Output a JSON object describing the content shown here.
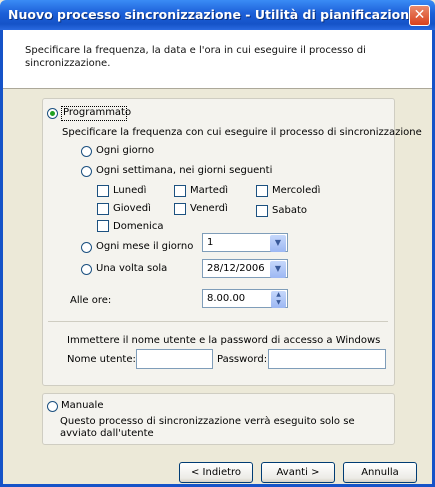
{
  "window": {
    "title": "Nuovo processo sincronizzazione - Utilità di pianificazione",
    "close_symbol": "✕"
  },
  "header": {
    "description": "Specificare la frequenza, la data e l'ora in cui eseguire il processo di sincronizzazione."
  },
  "scheduled": {
    "radio_label": "Programmato",
    "frequency_prompt": "Specificare la frequenza con cui eseguire il processo di sincronizzazione",
    "options": {
      "daily": "Ogni giorno",
      "weekly": "Ogni settimana, nei giorni seguenti",
      "monthly": "Ogni mese il giorno",
      "once": "Una volta sola"
    },
    "days": {
      "mon": "Lunedì",
      "tue": "Martedì",
      "wed": "Mercoledì",
      "thu": "Giovedì",
      "fri": "Venerdì",
      "sat": "Sabato",
      "sun": "Domenica"
    },
    "monthly_day_value": "1",
    "once_date_value": "28/12/2006",
    "time_label": "Alle ore:",
    "time_value": "8.00.00",
    "credentials_prompt": "Immettere il nome utente e la password di accesso a Windows",
    "username_label": "Nome utente:",
    "username_value": "",
    "password_label": "Password:",
    "password_value": ""
  },
  "manual": {
    "radio_label": "Manuale",
    "description": "Questo processo di sincronizzazione verrà eseguito solo se avviato dall'utente"
  },
  "buttons": {
    "back": "< Indietro",
    "next": "Avanti >",
    "cancel": "Annulla"
  },
  "icons": {
    "dropdown": "chevron-down-icon",
    "spinner": "up-down-arrows-icon",
    "close": "close-icon"
  },
  "colors": {
    "titlebar": "#1553c8",
    "dialog_background": "#ece9d8",
    "radio_dot": "#21a121",
    "close_button": "#d9411d"
  }
}
